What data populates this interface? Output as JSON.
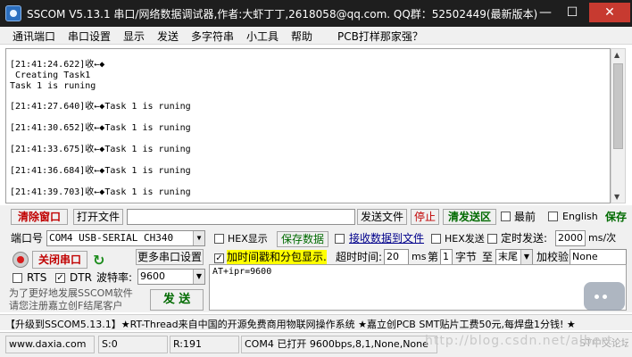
{
  "window": {
    "title": "SSCOM V5.13.1 串口/网络数据调试器,作者:大虾丁丁,2618058@qq.com. QQ群：52502449(最新版本)",
    "min_glyph": "—",
    "max_glyph": "☐",
    "close_glyph": "✕"
  },
  "menu": [
    "通讯端口",
    "串口设置",
    "显示",
    "发送",
    "多字符串",
    "小工具",
    "帮助",
    "PCB打样那家强？"
  ],
  "log": {
    "lines": [
      "[21:41:24.622]收←◆",
      " Creating Task1",
      "Task 1 is runing",
      "[21:41:27.640]收←◆Task 1 is runing",
      "[21:41:30.652]收←◆Task 1 is runing",
      "[21:41:33.675]收←◆Task 1 is runing",
      "[21:41:36.684]收←◆Task 1 is runing",
      "[21:41:39.703]收←◆Task 1 is runing"
    ]
  },
  "toolbar": {
    "clear_window": "清除窗口",
    "open_file": "打开文件",
    "send_file": "发送文件",
    "stop": "停止",
    "clear_send": "清发送区",
    "top_most": "最前",
    "english": "English",
    "save": "保存"
  },
  "port": {
    "label": "端口号",
    "value": "COM4 USB-SERIAL CH340",
    "close_port": "关闭串口",
    "more_settings": "更多串口设置",
    "rts": "RTS",
    "dtr": "DTR",
    "baud_label": "波特率:",
    "baud_value": "9600",
    "promo_line1": "为了更好地发展SSCOM软件",
    "promo_line2": "请您注册嘉立创F结尾客户",
    "send_button": "发  送"
  },
  "options": {
    "hex_display": "HEX显示",
    "save_data": "保存数据",
    "recv_to_file": "接收数据到文件",
    "hex_send": "HEX发送",
    "timed_send": "定时发送:",
    "timed_value": "2000",
    "timed_unit": "ms/次",
    "timestamp_split": "加时间戳和分包显示.",
    "timeout_label": "超时时间:",
    "timeout_value": "20",
    "timeout_unit": "ms",
    "nth_label": "第",
    "nth_value": "1",
    "byte_label": "字节",
    "to_label": "至",
    "end_value": "末尾",
    "checksum_label": "加校验",
    "checksum_value": "None"
  },
  "send_area": {
    "text": "AT+ipr=9600"
  },
  "ticker": {
    "text": "【升级到SSCOM5.13.1】★RT-Thread来自中国的开源免费商用物联网操作系统 ★嘉立创PCB SMT贴片工费50元,每焊盘1分钱! ★"
  },
  "status": {
    "website": "www.daxia.com",
    "sent": "S:0",
    "received": "R:191",
    "port_state": "COM4 已打开  9600bps,8,1,None,None",
    "watermark": "http://blog.csdn.net/albert",
    "trailing": "ST中文论坛"
  }
}
